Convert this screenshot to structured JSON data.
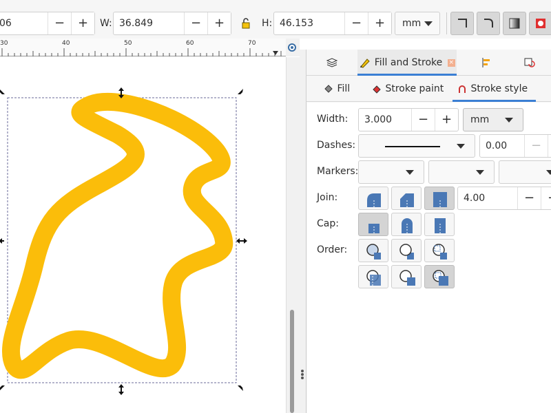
{
  "toolbar": {
    "x_value": "06",
    "w_label": "W:",
    "w_value": "36.849",
    "h_label": "H:",
    "h_value": "46.153",
    "unit": "mm",
    "minus": "−",
    "plus": "+"
  },
  "ruler": {
    "ticks": [
      "30",
      "40",
      "50",
      "60",
      "70"
    ]
  },
  "dialog_tabs": {
    "fill_and_stroke": "Fill and Stroke",
    "close": "×"
  },
  "subtabs": {
    "fill": "Fill",
    "stroke_paint": "Stroke paint",
    "stroke_style": "Stroke style"
  },
  "stroke_style": {
    "width_label": "Width:",
    "width_value": "3.000",
    "width_unit": "mm",
    "dashes_label": "Dashes:",
    "dash_offset": "0.00",
    "markers_label": "Markers:",
    "join_label": "Join:",
    "miter_value": "4.00",
    "cap_label": "Cap:",
    "order_label": "Order:"
  },
  "colors": {
    "stroke_color": "#fbbd0a",
    "accent": "#3a7fd4",
    "icon_blue": "#4a78b5"
  },
  "icons": [
    "layers-icon",
    "fill-stroke-icon",
    "align-icon",
    "undo-history-icon",
    "lock-icon",
    "fill-icon",
    "stroke-paint-icon",
    "stroke-style-icon"
  ]
}
